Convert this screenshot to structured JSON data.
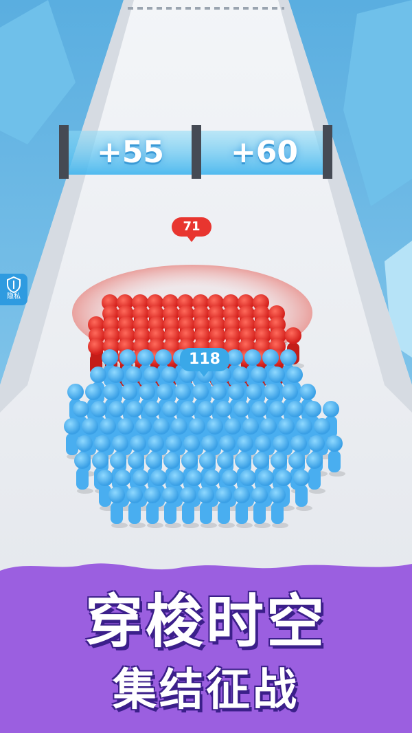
{
  "game": {
    "gates": [
      {
        "label": "+55"
      },
      {
        "label": "+60"
      }
    ],
    "enemy_crowd": {
      "count": "71",
      "color": "#e8352f"
    },
    "player_crowd": {
      "count": "118",
      "color": "#4fb8f0"
    },
    "privacy_button": {
      "label": "隐私",
      "icon": "shield-icon"
    }
  },
  "banner": {
    "title": "穿梭时空",
    "subtitle": "集结征战",
    "color": "#9b5fe0"
  }
}
